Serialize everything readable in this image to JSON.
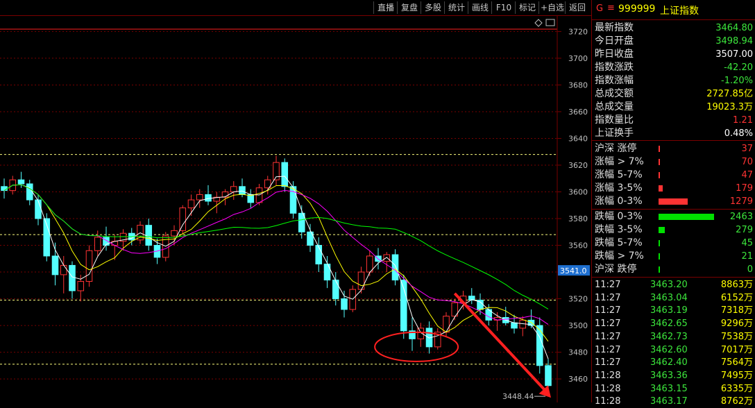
{
  "toolbar": {
    "buttons": [
      "直播",
      "复盘",
      "多股",
      "统计",
      "画线",
      "F10",
      "标记",
      "+自选",
      "返回"
    ]
  },
  "chart": {
    "y_ticks": [
      "3720",
      "3700",
      "3680",
      "3660",
      "3640",
      "3620",
      "3600",
      "3580",
      "3560",
      "3540",
      "3520",
      "3500",
      "3480",
      "3460"
    ],
    "current_price_label": "3541.0",
    "low_label": "3448.44",
    "diamond_icon": "diamond-icon",
    "colors": {
      "up": "#ff3333",
      "down": "#54ffff",
      "ma5": "#ffffff",
      "ma10": "#ffff00",
      "ma20": "#ff00ff",
      "ma60": "#00ff00",
      "grid": "#7a0000",
      "arrow": "#ff2020"
    }
  },
  "chart_data": {
    "type": "candlestick",
    "ylim": [
      3445,
      3728
    ],
    "candles": [
      [
        3604,
        3610,
        3595,
        3601
      ],
      [
        3601,
        3612,
        3598,
        3609
      ],
      [
        3609,
        3615,
        3603,
        3606
      ],
      [
        3606,
        3609,
        3590,
        3594
      ],
      [
        3594,
        3598,
        3575,
        3580
      ],
      [
        3580,
        3584,
        3548,
        3552
      ],
      [
        3552,
        3562,
        3530,
        3538
      ],
      [
        3538,
        3552,
        3524,
        3545
      ],
      [
        3545,
        3548,
        3520,
        3526
      ],
      [
        3526,
        3538,
        3518,
        3533
      ],
      [
        3533,
        3560,
        3529,
        3556
      ],
      [
        3556,
        3571,
        3552,
        3566
      ],
      [
        3566,
        3574,
        3556,
        3560
      ],
      [
        3560,
        3568,
        3549,
        3563
      ],
      [
        3563,
        3572,
        3556,
        3569
      ],
      [
        3569,
        3573,
        3560,
        3564
      ],
      [
        3564,
        3578,
        3561,
        3575
      ],
      [
        3575,
        3580,
        3556,
        3560
      ],
      [
        3560,
        3565,
        3546,
        3551
      ],
      [
        3551,
        3570,
        3548,
        3567
      ],
      [
        3567,
        3575,
        3560,
        3571
      ],
      [
        3571,
        3590,
        3568,
        3588
      ],
      [
        3588,
        3598,
        3582,
        3594
      ],
      [
        3594,
        3602,
        3588,
        3598
      ],
      [
        3598,
        3605,
        3590,
        3593
      ],
      [
        3593,
        3600,
        3584,
        3596
      ],
      [
        3596,
        3602,
        3590,
        3600
      ],
      [
        3600,
        3608,
        3594,
        3604
      ],
      [
        3604,
        3610,
        3596,
        3598
      ],
      [
        3598,
        3602,
        3588,
        3592
      ],
      [
        3592,
        3606,
        3590,
        3603
      ],
      [
        3603,
        3612,
        3598,
        3609
      ],
      [
        3609,
        3627,
        3605,
        3622
      ],
      [
        3622,
        3625,
        3600,
        3604
      ],
      [
        3604,
        3608,
        3580,
        3584
      ],
      [
        3584,
        3590,
        3565,
        3570
      ],
      [
        3570,
        3576,
        3555,
        3560
      ],
      [
        3560,
        3566,
        3540,
        3546
      ],
      [
        3546,
        3552,
        3528,
        3534
      ],
      [
        3534,
        3540,
        3515,
        3520
      ],
      [
        3520,
        3526,
        3506,
        3512
      ],
      [
        3512,
        3530,
        3510,
        3527
      ],
      [
        3527,
        3544,
        3524,
        3540
      ],
      [
        3540,
        3556,
        3537,
        3552
      ],
      [
        3552,
        3558,
        3542,
        3548
      ],
      [
        3548,
        3555,
        3540,
        3553
      ],
      [
        3553,
        3557,
        3530,
        3534
      ],
      [
        3534,
        3538,
        3490,
        3496
      ],
      [
        3496,
        3506,
        3481,
        3490
      ],
      [
        3490,
        3502,
        3484,
        3498
      ],
      [
        3498,
        3503,
        3479,
        3484
      ],
      [
        3484,
        3498,
        3482,
        3495
      ],
      [
        3495,
        3510,
        3492,
        3507
      ],
      [
        3507,
        3520,
        3504,
        3517
      ],
      [
        3517,
        3526,
        3512,
        3522
      ],
      [
        3522,
        3528,
        3516,
        3519
      ],
      [
        3519,
        3524,
        3508,
        3512
      ],
      [
        3512,
        3516,
        3500,
        3504
      ],
      [
        3504,
        3510,
        3496,
        3506
      ],
      [
        3506,
        3514,
        3500,
        3502
      ],
      [
        3502,
        3508,
        3494,
        3498
      ],
      [
        3498,
        3507,
        3492,
        3504
      ],
      [
        3504,
        3512,
        3498,
        3500
      ],
      [
        3500,
        3506,
        3464,
        3470
      ],
      [
        3470,
        3475,
        3452,
        3455
      ]
    ]
  },
  "quote": {
    "g_label": "G",
    "menu_icon": "≡",
    "code": "999999",
    "name": "上证指数",
    "rows": [
      {
        "label": "最新指数",
        "value": "3464.80",
        "color": "#3ce63c"
      },
      {
        "label": "今日开盘",
        "value": "3498.94",
        "color": "#3ce63c"
      },
      {
        "label": "昨日收盘",
        "value": "3507.00",
        "color": "#ffffff"
      },
      {
        "label": "指数涨跌",
        "value": "-42.20",
        "color": "#3ce63c"
      },
      {
        "label": "指数涨幅",
        "value": "-1.20%",
        "color": "#3ce63c"
      },
      {
        "label": "总成交额",
        "value": "2727.85亿",
        "color": "#ffff00"
      },
      {
        "label": "总成交量",
        "value": "19023.3万",
        "color": "#ffff00"
      },
      {
        "label": "指数量比",
        "value": "1.21",
        "color": "#ff3333"
      },
      {
        "label": "上证换手",
        "value": "0.48%",
        "color": "#ffffff"
      }
    ]
  },
  "distribution": {
    "up": [
      {
        "label": "沪深 涨停",
        "value": "37",
        "frac": 0.01
      },
      {
        "label": "涨幅 > 7%",
        "value": "70",
        "frac": 0.02
      },
      {
        "label": "涨幅 5-7%",
        "value": "47",
        "frac": 0.012
      },
      {
        "label": "涨幅 3-5%",
        "value": "179",
        "frac": 0.072
      },
      {
        "label": "涨幅 0-3%",
        "value": "1279",
        "frac": 0.52
      }
    ],
    "down": [
      {
        "label": "跌幅 0-3%",
        "value": "2463",
        "frac": 1.0
      },
      {
        "label": "跌幅 3-5%",
        "value": "279",
        "frac": 0.113
      },
      {
        "label": "跌幅 5-7%",
        "value": "45",
        "frac": 0.012
      },
      {
        "label": "跌幅 > 7%",
        "value": "21",
        "frac": 0.008
      },
      {
        "label": "沪深 跌停",
        "value": "0",
        "frac": 0.004
      }
    ],
    "up_color": "#ff3333",
    "down_color": "#00e000"
  },
  "ticks": [
    {
      "time": "11:27",
      "price": "3463.20",
      "vol": "8863万"
    },
    {
      "time": "11:27",
      "price": "3463.04",
      "vol": "6152万"
    },
    {
      "time": "11:27",
      "price": "3463.19",
      "vol": "7318万"
    },
    {
      "time": "11:27",
      "price": "3462.65",
      "vol": "9296万"
    },
    {
      "time": "11:27",
      "price": "3462.73",
      "vol": "7538万"
    },
    {
      "time": "11:27",
      "price": "3462.60",
      "vol": "7017万"
    },
    {
      "time": "11:27",
      "price": "3462.40",
      "vol": "7564万"
    },
    {
      "time": "11:28",
      "price": "3463.36",
      "vol": "7495万"
    },
    {
      "time": "11:28",
      "price": "3463.15",
      "vol": "6335万"
    },
    {
      "time": "11:28",
      "price": "3463.17",
      "vol": "8762万"
    }
  ]
}
